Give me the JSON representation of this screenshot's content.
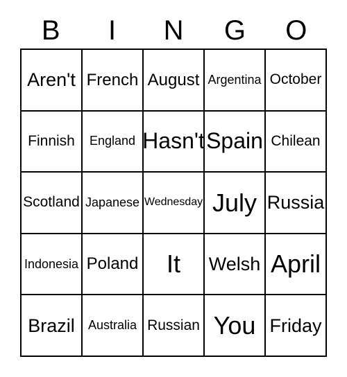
{
  "card": {
    "title": "BINGO Card",
    "header_letters": [
      "B",
      "I",
      "N",
      "G",
      "O"
    ],
    "rows": [
      [
        {
          "text": "Aren't",
          "size": "xl"
        },
        {
          "text": "French",
          "size": "l"
        },
        {
          "text": "August",
          "size": "l"
        },
        {
          "text": "Argentina",
          "size": "s"
        },
        {
          "text": "October",
          "size": "m"
        }
      ],
      [
        {
          "text": "Finnish",
          "size": "m"
        },
        {
          "text": "England",
          "size": "s"
        },
        {
          "text": "Hasn't",
          "size": "xxl"
        },
        {
          "text": "Spain",
          "size": "xxl"
        },
        {
          "text": "Chilean",
          "size": "m"
        }
      ],
      [
        {
          "text": "Scotland",
          "size": "m"
        },
        {
          "text": "Japanese",
          "size": "s"
        },
        {
          "text": "Wednesday",
          "size": "xs"
        },
        {
          "text": "July",
          "size": "xxxl"
        },
        {
          "text": "Russia",
          "size": "xl"
        }
      ],
      [
        {
          "text": "Indonesia",
          "size": "s"
        },
        {
          "text": "Poland",
          "size": "l"
        },
        {
          "text": "It",
          "size": "xxxl"
        },
        {
          "text": "Welsh",
          "size": "xl"
        },
        {
          "text": "April",
          "size": "xxxl"
        }
      ],
      [
        {
          "text": "Brazil",
          "size": "xl"
        },
        {
          "text": "Australia",
          "size": "s"
        },
        {
          "text": "Russian",
          "size": "m"
        },
        {
          "text": "You",
          "size": "xxxl"
        },
        {
          "text": "Friday",
          "size": "xl"
        }
      ]
    ]
  }
}
